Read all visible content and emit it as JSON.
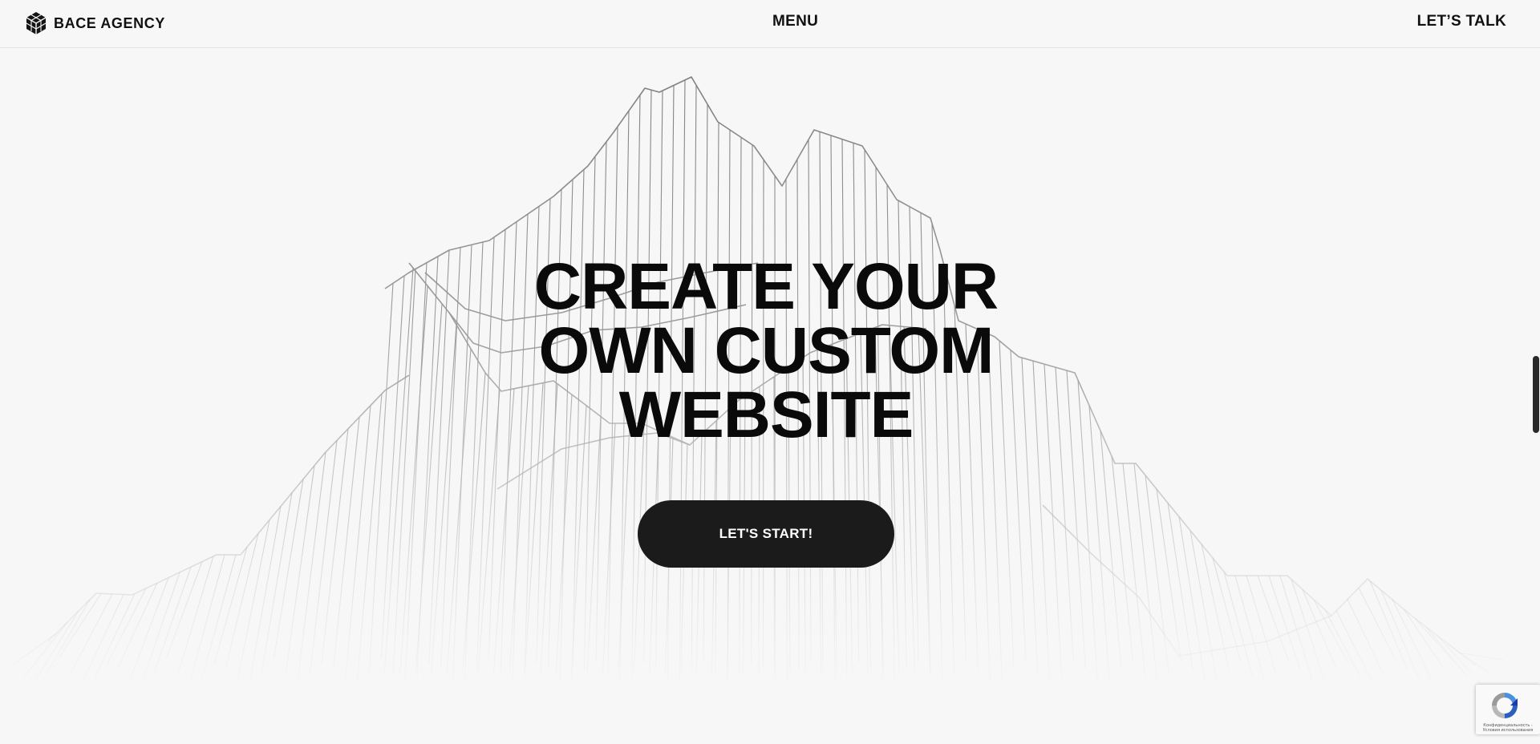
{
  "header": {
    "brand_name": "BACE AGENCY",
    "menu_label": "MENU",
    "talk_label": "LET’S TALK"
  },
  "hero": {
    "title_lines": [
      "CREATE YOUR",
      "OWN CUSTOM",
      "WEBSITE"
    ],
    "cta_label": "LET'S START!"
  },
  "recaptcha": {
    "text": "Конфиденциальность - Условия использования"
  },
  "colors": {
    "background": "#f7f7f7",
    "text": "#111111",
    "button": "#1b1b1b",
    "button_text": "#ffffff",
    "wireframe": "#8a8a8a"
  },
  "icons": {
    "logo": "cube-logo-icon",
    "recaptcha": "recaptcha-icon"
  }
}
